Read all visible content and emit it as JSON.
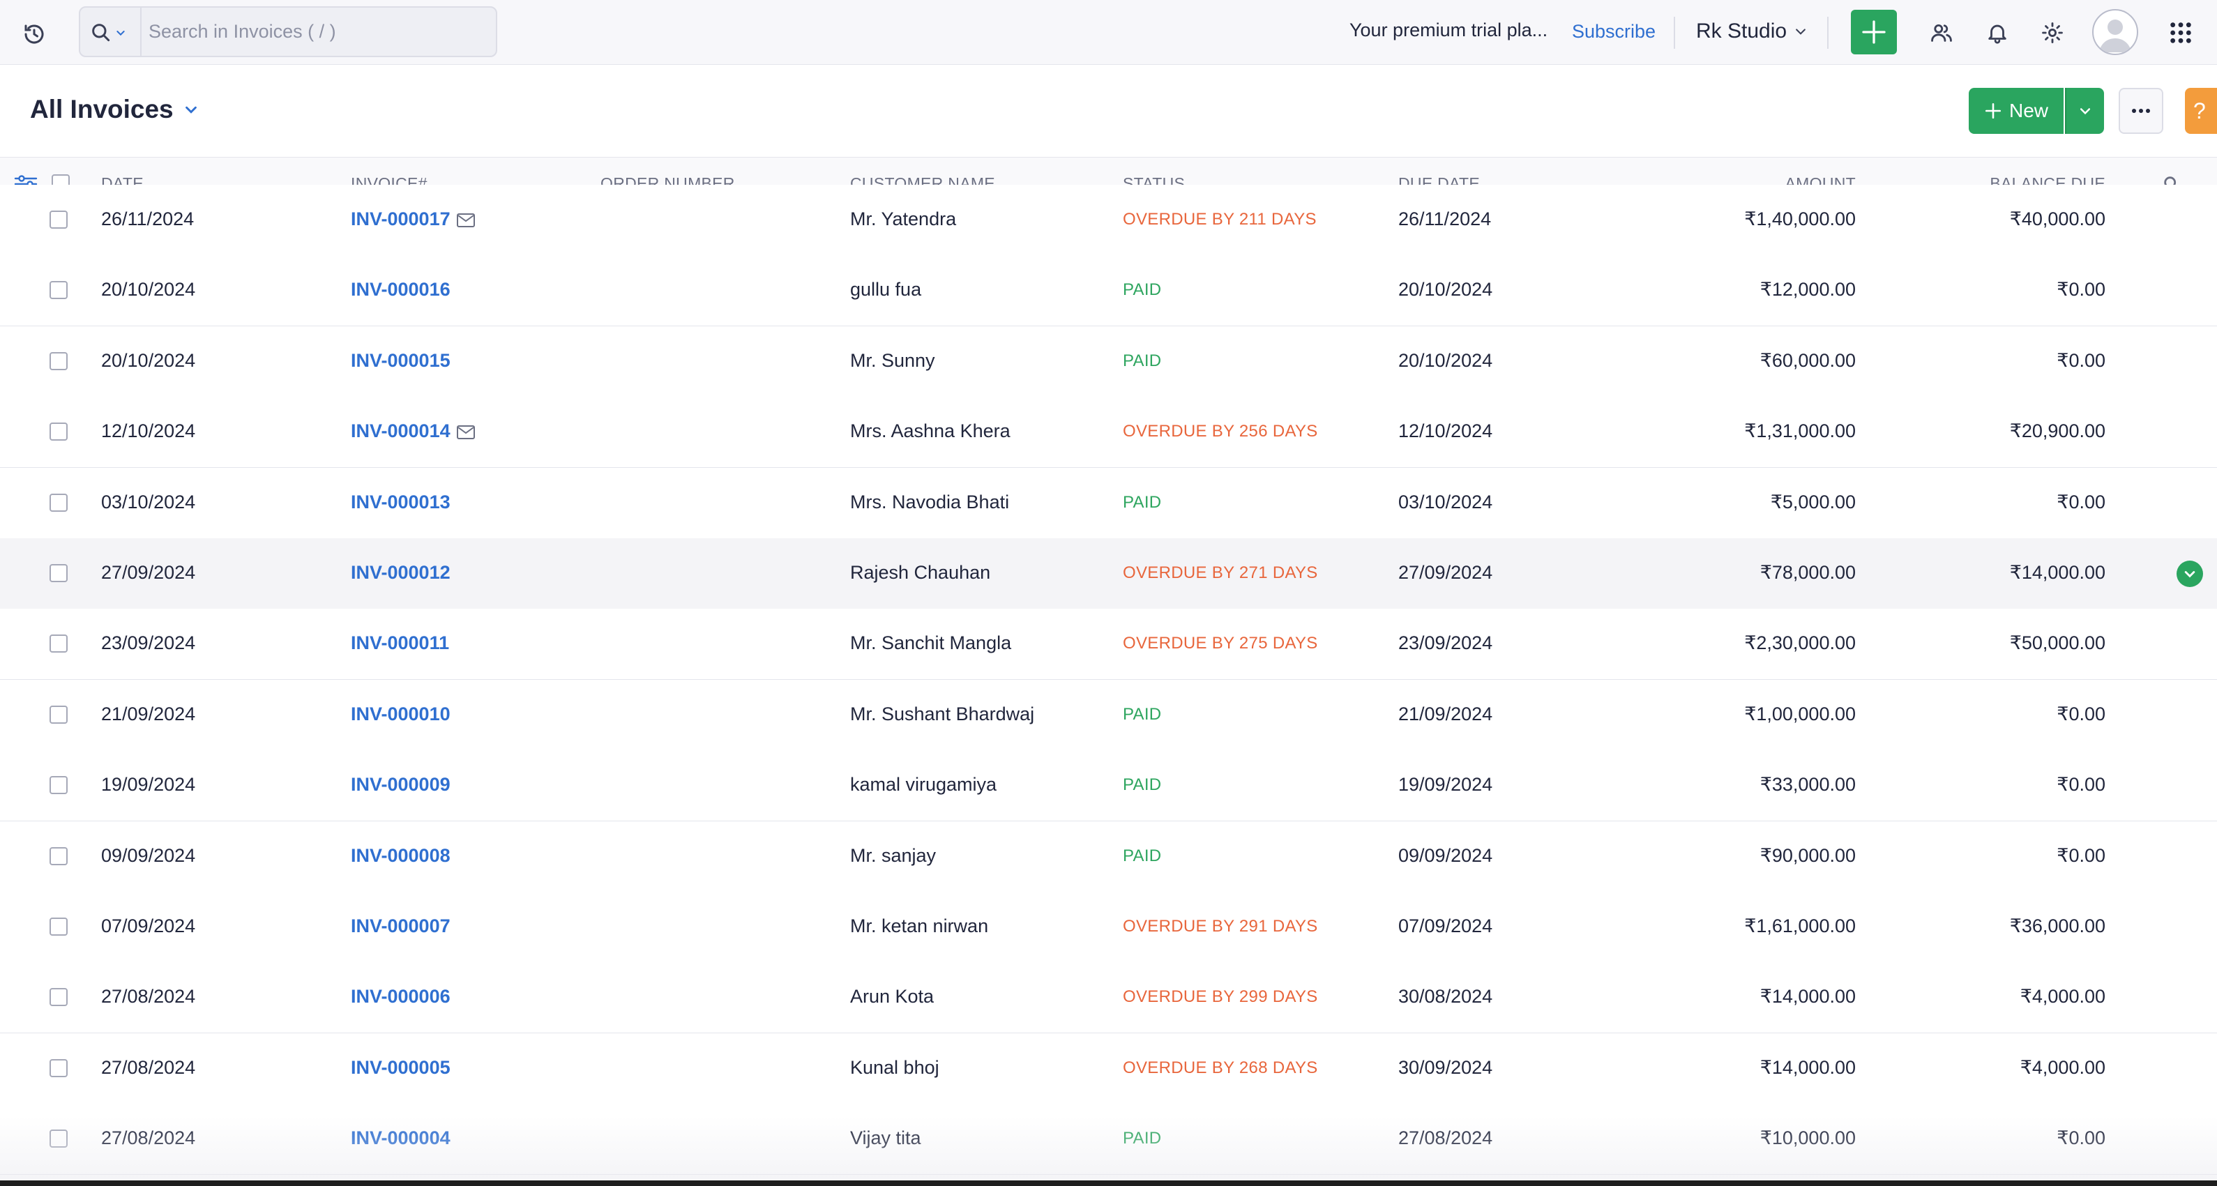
{
  "topbar": {
    "search_placeholder": "Search in Invoices ( / )",
    "trial_text": "Your premium trial pla...",
    "subscribe_label": "Subscribe",
    "org_name": "Rk Studio"
  },
  "page": {
    "title": "All Invoices",
    "new_label": "New",
    "help_label": "?"
  },
  "colors": {
    "accent_green": "#2aa55f",
    "link_blue": "#2f6fd0",
    "overdue_orange": "#e8663c",
    "paid_green": "#2ea55f"
  },
  "table": {
    "headers": {
      "date": "DATE",
      "invoice": "INVOICE#",
      "order": "ORDER NUMBER",
      "customer": "CUSTOMER NAME",
      "status": "STATUS",
      "due": "DUE DATE",
      "amount": "AMOUNT",
      "balance": "BALANCE DUE"
    },
    "rows": [
      {
        "date": "26/11/2024",
        "invoice": "INV-000017",
        "mail": true,
        "order": "",
        "customer": "Mr. Yatendra",
        "status": "OVERDUE BY 211 DAYS",
        "status_type": "overdue",
        "due": "26/11/2024",
        "amount": "₹1,40,000.00",
        "balance": "₹40,000.00"
      },
      {
        "date": "20/10/2024",
        "invoice": "INV-000016",
        "mail": false,
        "order": "",
        "customer": "gullu fua",
        "status": "PAID",
        "status_type": "paid",
        "due": "20/10/2024",
        "amount": "₹12,000.00",
        "balance": "₹0.00"
      },
      {
        "date": "20/10/2024",
        "invoice": "INV-000015",
        "mail": false,
        "order": "",
        "customer": "Mr. Sunny",
        "status": "PAID",
        "status_type": "paid",
        "due": "20/10/2024",
        "amount": "₹60,000.00",
        "balance": "₹0.00"
      },
      {
        "date": "12/10/2024",
        "invoice": "INV-000014",
        "mail": true,
        "order": "",
        "customer": "Mrs. Aashna Khera",
        "status": "OVERDUE BY 256 DAYS",
        "status_type": "overdue",
        "due": "12/10/2024",
        "amount": "₹1,31,000.00",
        "balance": "₹20,900.00"
      },
      {
        "date": "03/10/2024",
        "invoice": "INV-000013",
        "mail": false,
        "order": "",
        "customer": "Mrs. Navodia Bhati",
        "status": "PAID",
        "status_type": "paid",
        "due": "03/10/2024",
        "amount": "₹5,000.00",
        "balance": "₹0.00"
      },
      {
        "date": "27/09/2024",
        "invoice": "INV-000012",
        "mail": false,
        "order": "",
        "customer": "Rajesh Chauhan",
        "status": "OVERDUE BY 271 DAYS",
        "status_type": "overdue",
        "due": "27/09/2024",
        "amount": "₹78,000.00",
        "balance": "₹14,000.00",
        "highlighted": true
      },
      {
        "date": "23/09/2024",
        "invoice": "INV-000011",
        "mail": false,
        "order": "",
        "customer": "Mr. Sanchit Mangla",
        "status": "OVERDUE BY 275 DAYS",
        "status_type": "overdue",
        "due": "23/09/2024",
        "amount": "₹2,30,000.00",
        "balance": "₹50,000.00"
      },
      {
        "date": "21/09/2024",
        "invoice": "INV-000010",
        "mail": false,
        "order": "",
        "customer": "Mr. Sushant Bhardwaj",
        "status": "PAID",
        "status_type": "paid",
        "due": "21/09/2024",
        "amount": "₹1,00,000.00",
        "balance": "₹0.00"
      },
      {
        "date": "19/09/2024",
        "invoice": "INV-000009",
        "mail": false,
        "order": "",
        "customer": "kamal virugamiya",
        "status": "PAID",
        "status_type": "paid",
        "due": "19/09/2024",
        "amount": "₹33,000.00",
        "balance": "₹0.00"
      },
      {
        "date": "09/09/2024",
        "invoice": "INV-000008",
        "mail": false,
        "order": "",
        "customer": "Mr. sanjay",
        "status": "PAID",
        "status_type": "paid",
        "due": "09/09/2024",
        "amount": "₹90,000.00",
        "balance": "₹0.00"
      },
      {
        "date": "07/09/2024",
        "invoice": "INV-000007",
        "mail": false,
        "order": "",
        "customer": "Mr. ketan nirwan",
        "status": "OVERDUE BY 291 DAYS",
        "status_type": "overdue",
        "due": "07/09/2024",
        "amount": "₹1,61,000.00",
        "balance": "₹36,000.00"
      },
      {
        "date": "27/08/2024",
        "invoice": "INV-000006",
        "mail": false,
        "order": "",
        "customer": "Arun Kota",
        "status": "OVERDUE BY 299 DAYS",
        "status_type": "overdue",
        "due": "30/08/2024",
        "amount": "₹14,000.00",
        "balance": "₹4,000.00"
      },
      {
        "date": "27/08/2024",
        "invoice": "INV-000005",
        "mail": false,
        "order": "",
        "customer": "Kunal bhoj",
        "status": "OVERDUE BY 268 DAYS",
        "status_type": "overdue",
        "due": "30/09/2024",
        "amount": "₹14,000.00",
        "balance": "₹4,000.00"
      },
      {
        "date": "27/08/2024",
        "invoice": "INV-000004",
        "mail": false,
        "order": "",
        "customer": "Vijay tita",
        "status": "PAID",
        "status_type": "paid",
        "due": "27/08/2024",
        "amount": "₹10,000.00",
        "balance": "₹0.00"
      }
    ]
  }
}
